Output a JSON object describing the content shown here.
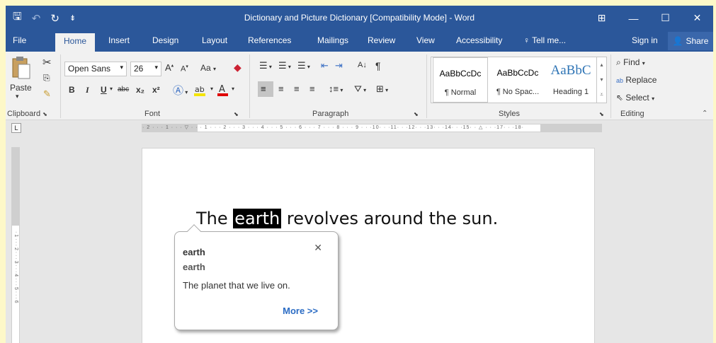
{
  "window": {
    "title": "Dictionary and Picture Dictionary [Compatibility Mode] - Word",
    "controls": {
      "ribbon_display": "⊞",
      "minimize": "—",
      "maximize": "☐",
      "close": "✕"
    }
  },
  "qat": {
    "save": "🖫",
    "undo": "↶",
    "undo_dd": "·",
    "redo": "↻",
    "customize": "⇟"
  },
  "tabs": [
    "File",
    "Home",
    "Insert",
    "Design",
    "Layout",
    "References",
    "Mailings",
    "Review",
    "View",
    "Accessibility"
  ],
  "tell_me": "Tell me...",
  "sign_in": "Sign in",
  "share": "Share",
  "ribbon": {
    "clipboard": {
      "paste": "Paste",
      "label": "Clipboard"
    },
    "font": {
      "name": "Open Sans",
      "size": "26",
      "grow": "A",
      "shrink": "A",
      "case": "Aa",
      "bold": "B",
      "italic": "I",
      "underline": "U",
      "strike": "abc",
      "subscript": "x₂",
      "superscript": "x²",
      "label": "Font"
    },
    "paragraph": {
      "sort": "A↓",
      "pilcrow": "¶",
      "label": "Paragraph"
    },
    "styles": {
      "items": [
        {
          "sample": "AaBbCcDc",
          "name": "¶ Normal"
        },
        {
          "sample": "AaBbCcDc",
          "name": "¶ No Spac..."
        },
        {
          "sample": "AaBbC",
          "name": "Heading 1"
        }
      ],
      "label": "Styles"
    },
    "editing": {
      "find": "Find",
      "replace": "Replace",
      "select": "Select",
      "label": "Editing"
    }
  },
  "ruler": {
    "tab_selector": "L",
    "horizontal": "· 2 · · · 1 · · · ▽ · · · 1 · · · 2 · · · 3 · · · 4 · · · 5 · · · 6 · · · 7 · · · 8 · · · 9 · · ·10· · ·11· · ·12· · ·13· · ·14· · ·15· · △ · · ·17· · ·18·",
    "vertical": "· 1 · · · 2 · · · 3 · · · 4 · · · 5 · · · 6"
  },
  "document": {
    "before": "The ",
    "highlight": "earth",
    "after": " revolves around the sun."
  },
  "dictionary_popup": {
    "word": "earth",
    "headword": "earth",
    "definition": "The planet that we live on.",
    "more": "More >>",
    "close": "✕"
  },
  "colors": {
    "accent": "#2B579A",
    "ribbon_bg": "#F1F1F1",
    "link": "#2B6CC4"
  }
}
